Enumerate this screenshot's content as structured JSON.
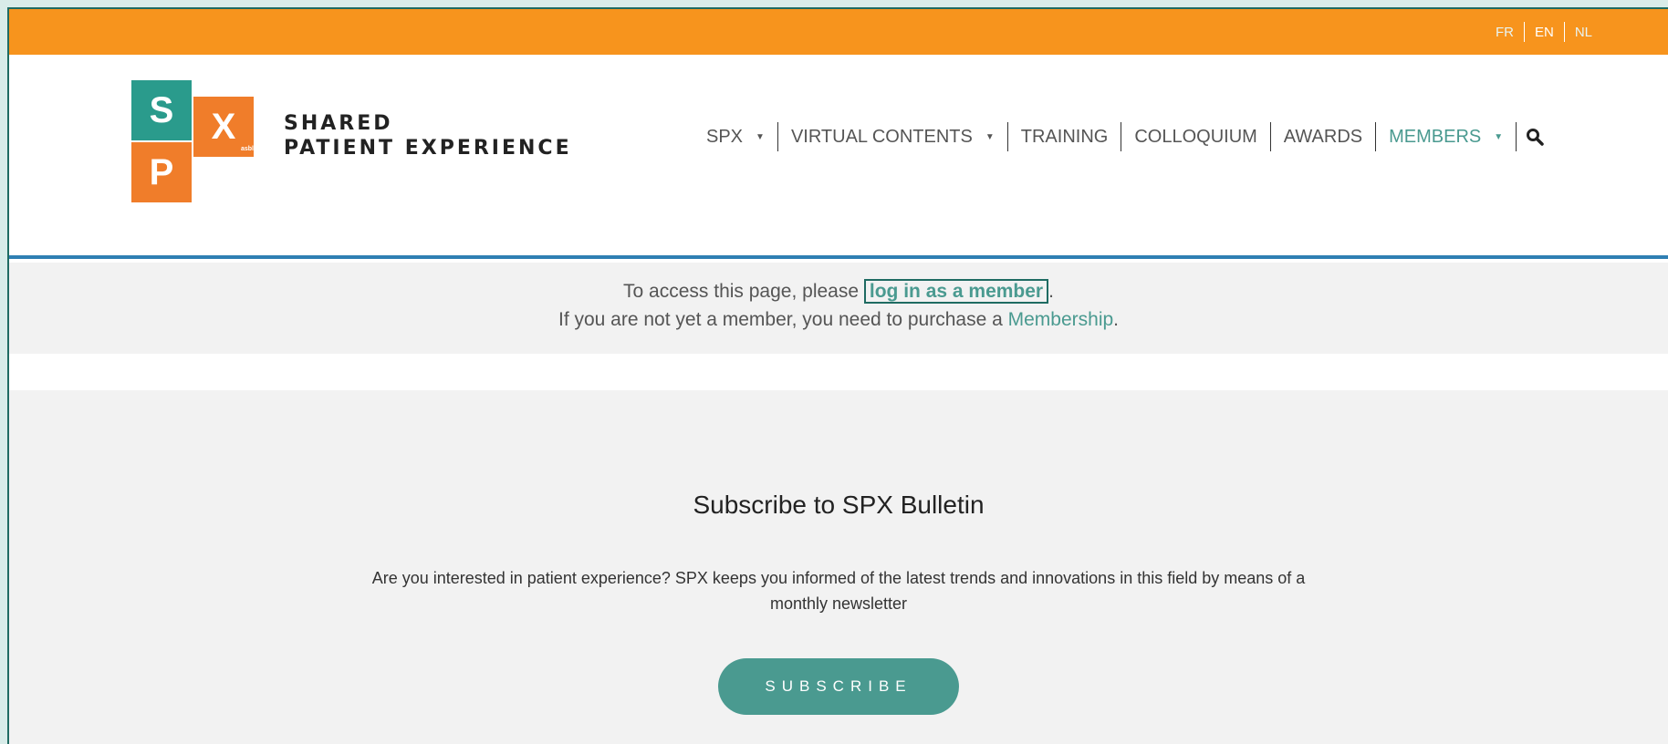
{
  "languages": [
    {
      "code": "FR",
      "active": false
    },
    {
      "code": "EN",
      "active": true
    },
    {
      "code": "NL",
      "active": false
    }
  ],
  "logo": {
    "s": "S",
    "x": "X",
    "p": "P",
    "asbl": "asbl"
  },
  "brand": {
    "line1": "SHARED",
    "line2": "PATIENT EXPERIENCE"
  },
  "nav": {
    "spx": "SPX",
    "virtual": "VIRTUAL CONTENTS",
    "training": "TRAINING",
    "colloquium": "COLLOQUIUM",
    "awards": "AWARDS",
    "members": "MEMBERS",
    "caret": "▼",
    "search_icon": "search-icon"
  },
  "notice": {
    "line1_prefix": "To access this page, please",
    "login_link": "log in as a member",
    "line1_suffix": ".",
    "line2_prefix": "If you are not yet a member, you need to purchase a",
    "membership_link": "Membership",
    "line2_suffix": "."
  },
  "subscribe": {
    "title": "Subscribe to SPX Bulletin",
    "body": "Are you interested in patient experience? SPX keeps you informed of the latest trends and innovations in this field by means of a monthly newsletter",
    "button": "SUBSCRIBE"
  },
  "colors": {
    "topbar": "#f7941d",
    "accent": "#4a9a90",
    "logo_teal": "#2a9b8c",
    "logo_orange": "#f07d2a",
    "header_rule": "#2f7fb3"
  }
}
